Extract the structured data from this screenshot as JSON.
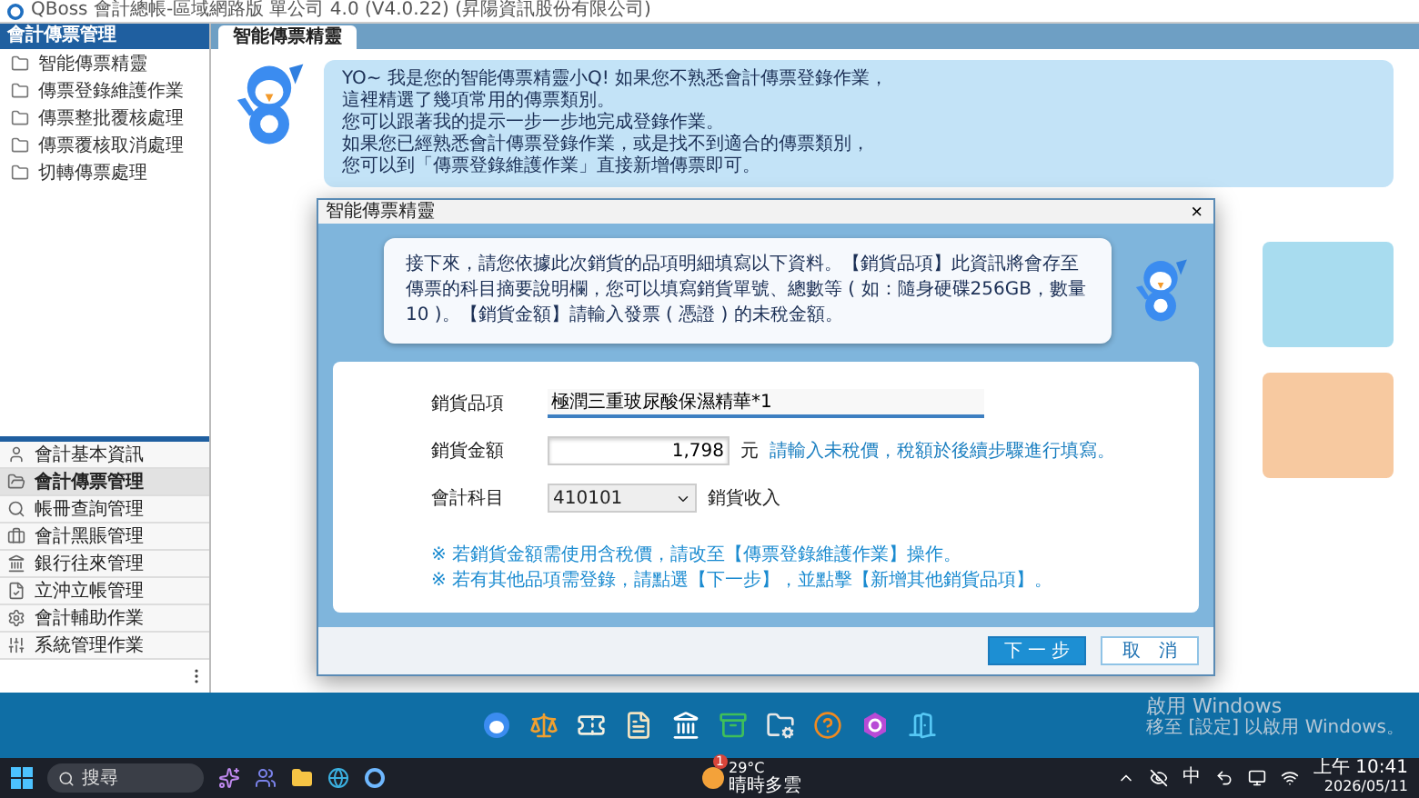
{
  "window": {
    "title": "QBoss 會計總帳-區域網路版 單公司 4.0 (V4.0.22) (昇陽資訊股份有限公司)"
  },
  "sidebar": {
    "header": "會計傳票管理",
    "items": [
      {
        "label": "智能傳票精靈"
      },
      {
        "label": "傳票登錄維護作業"
      },
      {
        "label": "傳票整批覆核處理"
      },
      {
        "label": "傳票覆核取消處理"
      },
      {
        "label": "切轉傳票處理"
      }
    ]
  },
  "modules": [
    {
      "label": "會計基本資訊",
      "selected": false
    },
    {
      "label": "會計傳票管理",
      "selected": true
    },
    {
      "label": "帳冊查詢管理",
      "selected": false
    },
    {
      "label": "會計黑賬管理",
      "selected": false
    },
    {
      "label": "銀行往來管理",
      "selected": false
    },
    {
      "label": "立沖立帳管理",
      "selected": false
    },
    {
      "label": "會計輔助作業",
      "selected": false
    },
    {
      "label": "系統管理作業",
      "selected": false
    }
  ],
  "tabs": [
    {
      "label": "智能傳票精靈",
      "selected": true
    }
  ],
  "banner": {
    "lines": [
      "YO~ 我是您的智能傳票精靈小Q! 如果您不熟悉會計傳票登錄作業，",
      "這裡精選了幾項常用的傳票類別。",
      "您可以跟著我的提示一步一步地完成登錄作業。",
      "如果您已經熟悉會計傳票登錄作業，或是找不到適合的傳票類別，",
      "您可以到「傳票登錄維護作業」直接新增傳票即可。"
    ]
  },
  "dialog": {
    "title": "智能傳票精靈",
    "close": "×",
    "message": "接下來，請您依據此次銷貨的品項明細填寫以下資料。【銷貨品項】此資訊將會存至傳票的科目摘要說明欄，您可以填寫銷貨單號、總數等 ( 如：隨身硬碟256GB，數量10 )。【銷貨金額】請輸入發票 ( 憑證 ) 的未稅金額。",
    "fields": [
      {
        "kind": "text",
        "label": "銷貨品項",
        "value": "極潤三重玻尿酸保濕精華*1"
      },
      {
        "kind": "amount",
        "label": "銷貨金額",
        "value": "1,798",
        "unit": "元",
        "hint": "請輸入未稅價，稅額於後續步驟進行填寫。"
      },
      {
        "kind": "select",
        "label": "會計科目",
        "value": "410101",
        "caption": "銷貨收入"
      }
    ],
    "notes": [
      "※ 若銷貨金額需使用含稅價，請改至【傳票登錄維護作業】操作。",
      "※ 若有其他品項需登錄，請點選【下一步】，並點擊【新增其他銷貨品項】。"
    ],
    "buttons": [
      {
        "label": "下 一 步",
        "kind": "primary"
      },
      {
        "label": "取　消",
        "kind": "secondary"
      }
    ]
  },
  "activation": {
    "title": "啟用 Windows",
    "hint": "移至 [設定] 以啟用 Windows。"
  },
  "taskbar": {
    "search_placeholder": "搜尋",
    "weather": {
      "temp": "29°C",
      "condition": "晴時多雲",
      "badge": "1"
    },
    "ime": "中",
    "time": "上午 10:41",
    "date": "2026/05/11"
  }
}
